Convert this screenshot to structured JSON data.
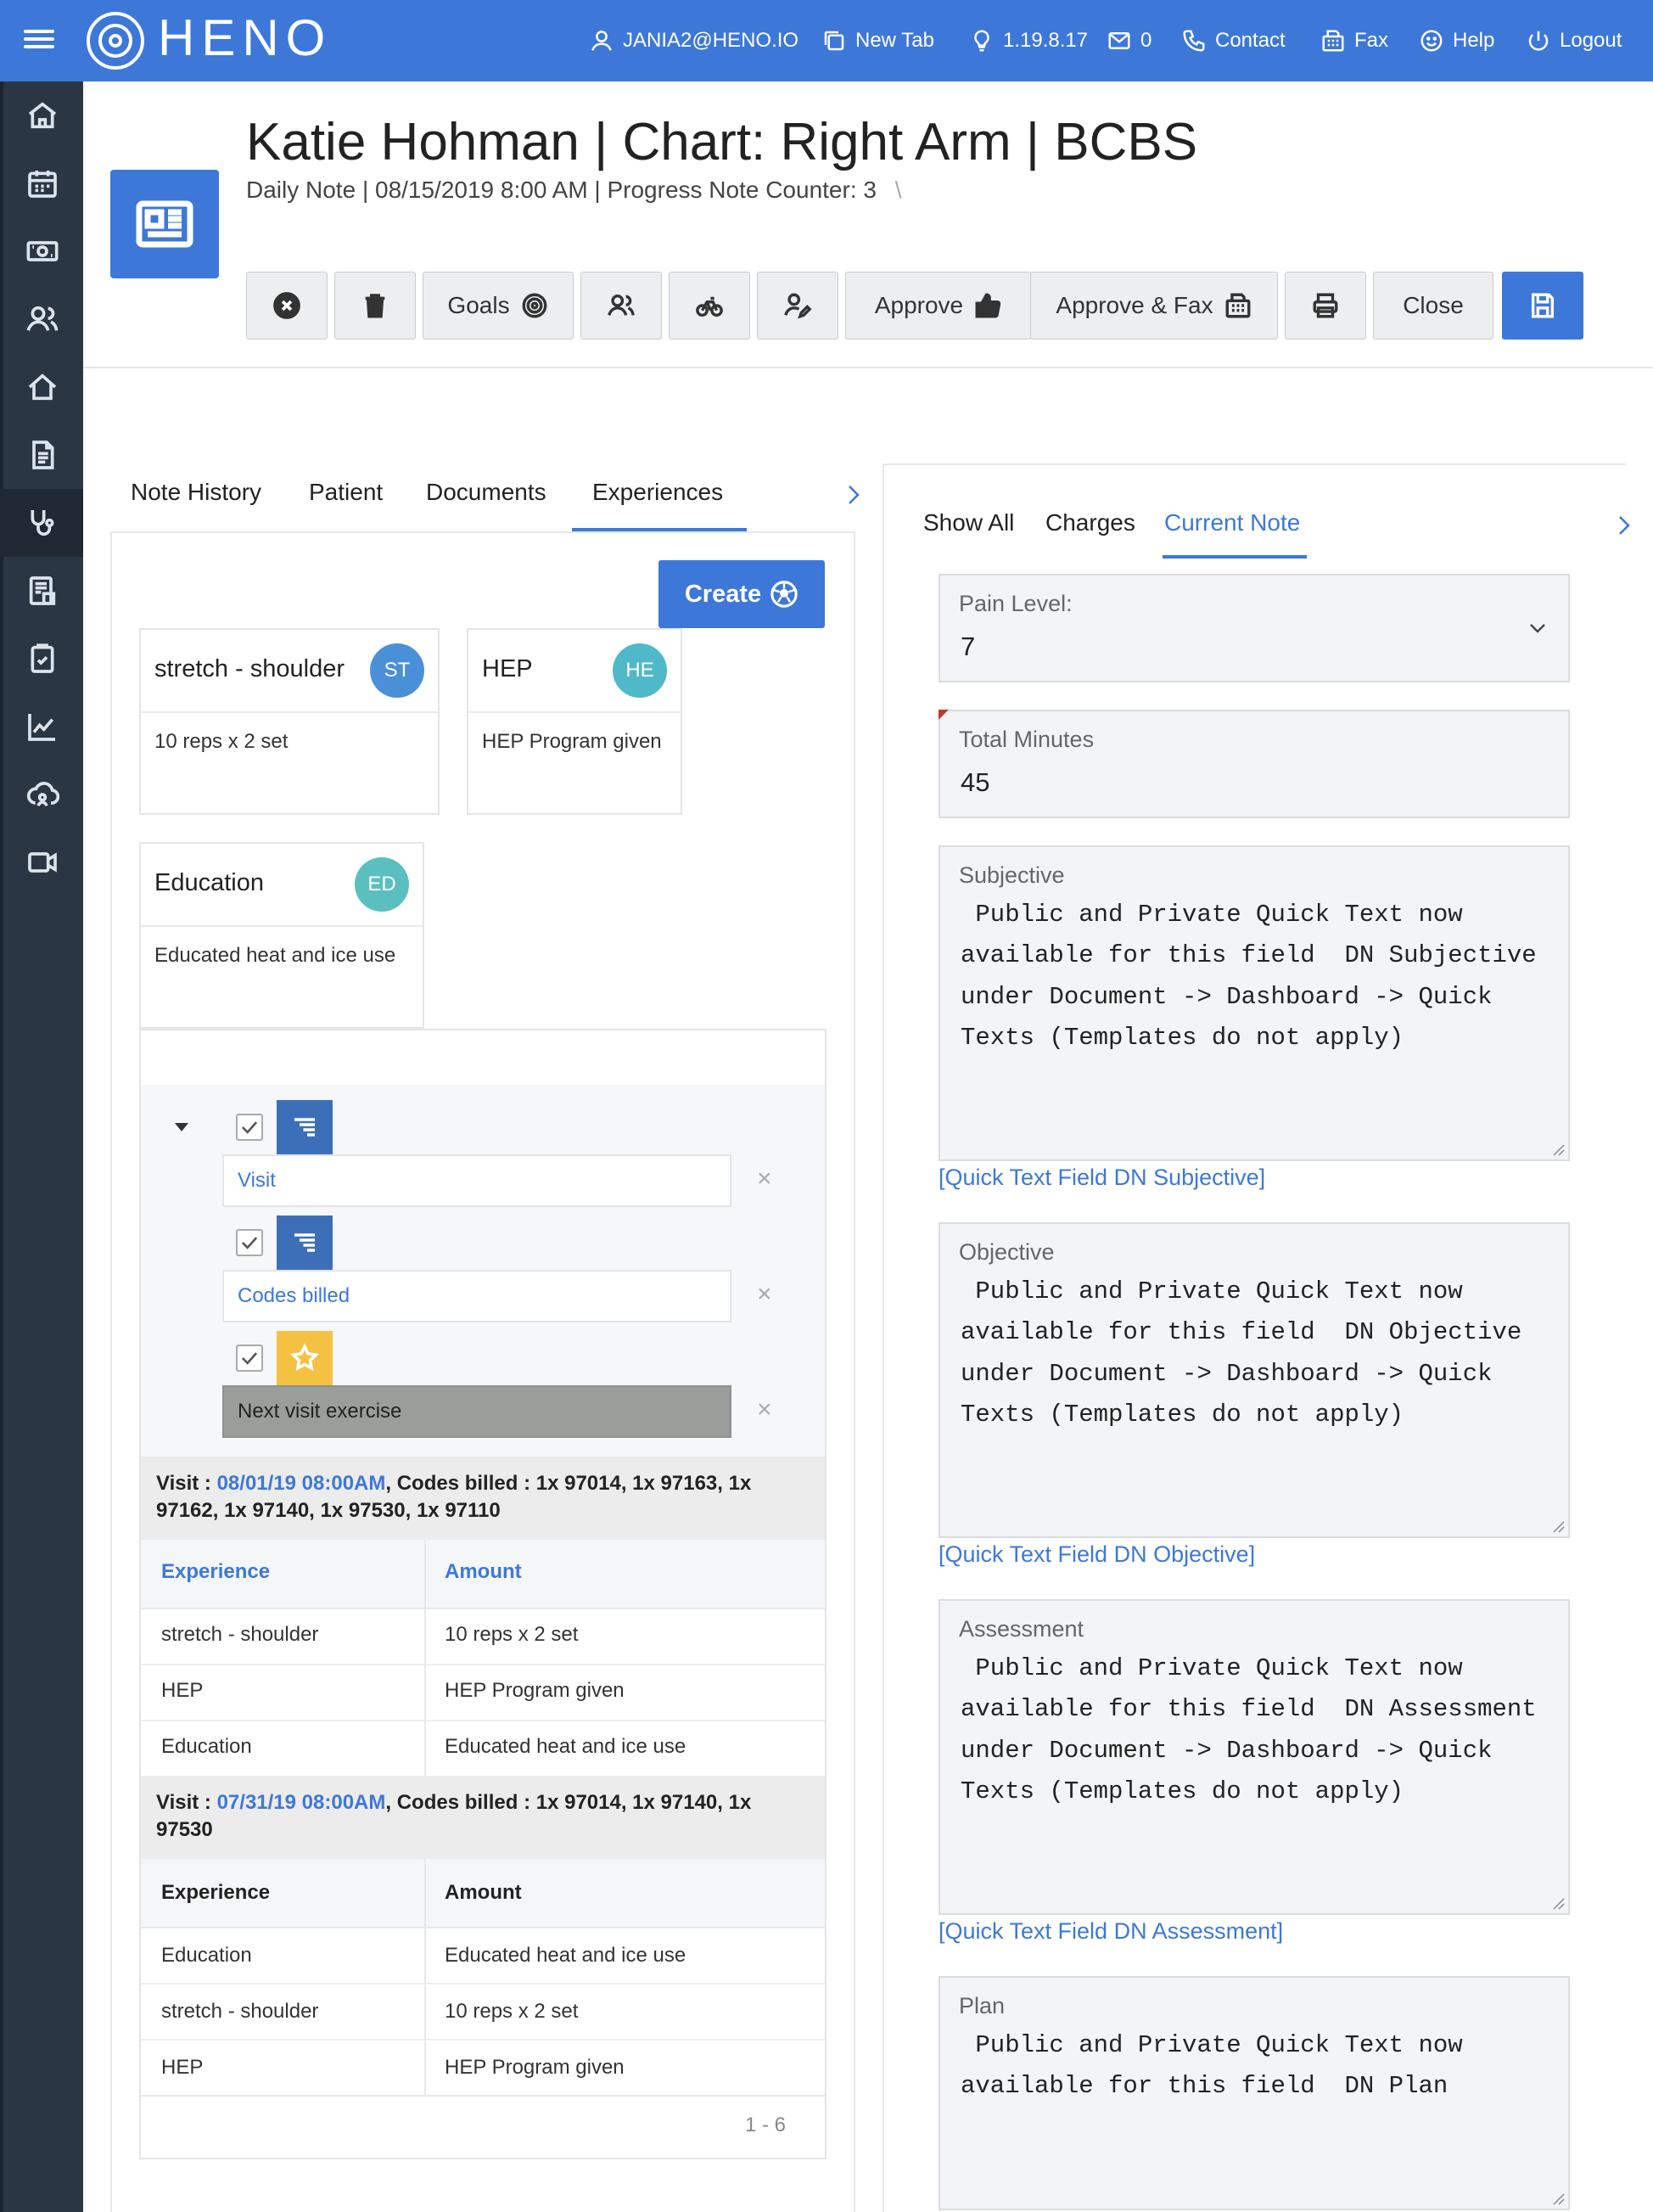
{
  "topbar": {
    "logo": "HENO",
    "user": "JANIA2@HENO.IO",
    "new_tab": "New Tab",
    "version": "1.19.8.17",
    "mail_count": "0",
    "contact": "Contact",
    "fax": "Fax",
    "help": "Help",
    "logout": "Logout"
  },
  "header": {
    "title": "Katie Hohman | Chart: Right Arm | BCBS",
    "subtitle": "Daily Note | 08/15/2019 8:00 AM | Progress Note Counter: 3",
    "subtitle_slash": "\\"
  },
  "toolbar": {
    "goals": "Goals",
    "approve": "Approve",
    "approve_fax": "Approve & Fax",
    "close": "Close"
  },
  "left_tabs": [
    "Note History",
    "Patient",
    "Documents",
    "Experiences"
  ],
  "create_label": "Create",
  "cards": [
    {
      "title": "stretch - shoulder",
      "badge": "ST",
      "badge_color": "#4a90d9",
      "body": "10 reps x 2 set"
    },
    {
      "title": "HEP",
      "badge": "HE",
      "badge_color": "#4fb8c9",
      "body": "HEP Program given"
    },
    {
      "title": "Education",
      "badge": "ED",
      "badge_color": "#5bbfbf",
      "body": "Educated heat and ice use"
    }
  ],
  "tree": {
    "fields": [
      "Visit",
      "Codes billed",
      "Next visit exercise"
    ]
  },
  "visits": [
    {
      "label": "Visit : ",
      "date": "08/01/19 08:00AM",
      "codes_label": ", Codes billed : ",
      "codes_line1": "1x 97014, 1x 97163, 1x",
      "codes_line2": "97162, 1x 97140, 1x 97530, 1x 97110",
      "col_experience": "Experience",
      "col_amount": "Amount",
      "rows": [
        {
          "experience": "stretch - shoulder",
          "amount": "10 reps x 2 set"
        },
        {
          "experience": "HEP",
          "amount": "HEP Program given"
        },
        {
          "experience": "Education",
          "amount": "Educated heat and ice use"
        }
      ]
    },
    {
      "label": "Visit : ",
      "date": "07/31/19 08:00AM",
      "codes_label": ", Codes billed : ",
      "codes_line1": "1x 97014, 1x 97140, 1x",
      "codes_line2": "97530",
      "col_experience": "Experience",
      "col_amount": "Amount",
      "rows": [
        {
          "experience": "Education",
          "amount": "Educated heat and ice use"
        },
        {
          "experience": "stretch - shoulder",
          "amount": "10 reps x 2 set"
        },
        {
          "experience": "HEP",
          "amount": "HEP Program given"
        }
      ]
    }
  ],
  "pager": "1 - 6",
  "right_tabs": [
    "Show All",
    "Charges",
    "Current Note"
  ],
  "pain": {
    "label": "Pain Level:",
    "value": "7"
  },
  "minutes": {
    "label": "Total Minutes",
    "value": "45"
  },
  "subjective": {
    "label": "Subjective",
    "text": " Public and Private Quick Text now\navailable for this field  DN Subjective\nunder Document -> Dashboard -> Quick\nTexts (Templates do not apply)",
    "link": "[Quick Text Field DN Subjective]"
  },
  "objective": {
    "label": "Objective",
    "text": " Public and Private Quick Text now\navailable for this field  DN Objective\nunder Document -> Dashboard -> Quick\nTexts (Templates do not apply)",
    "link": "[Quick Text Field DN Objective]"
  },
  "assessment": {
    "label": "Assessment",
    "text": " Public and Private Quick Text now\navailable for this field  DN Assessment\nunder Document -> Dashboard -> Quick\nTexts (Templates do not apply)",
    "link": "[Quick Text Field DN Assessment]"
  },
  "plan": {
    "label": "Plan",
    "text": " Public and Private Quick Text now\navailable for this field  DN Plan"
  },
  "colors": {
    "accent": "#3d78d8",
    "sidebar": "#2a3644",
    "star_tile": "#f4c142",
    "selected_row": "#9a9e9a"
  }
}
